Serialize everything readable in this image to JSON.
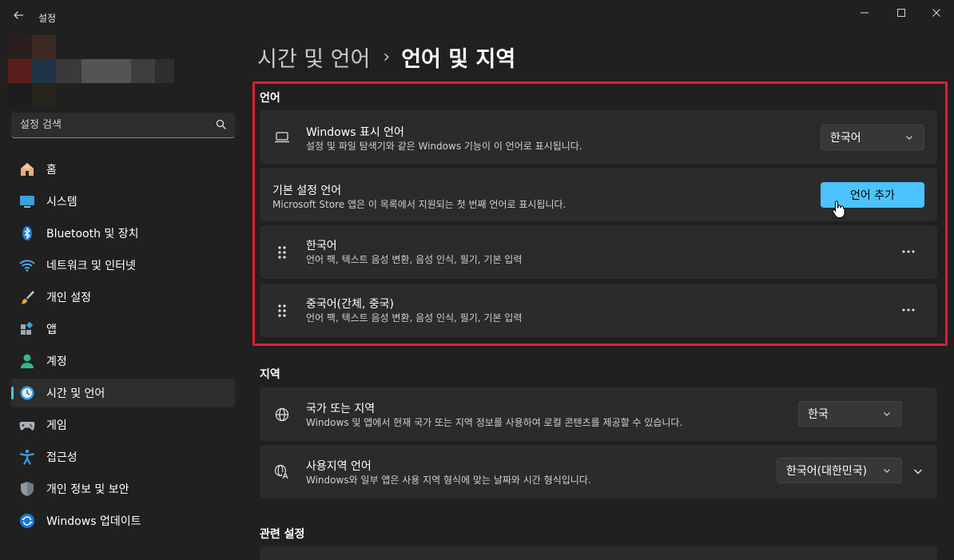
{
  "window": {
    "app_title": "설정",
    "back_icon": "back-arrow-icon"
  },
  "search": {
    "placeholder": "설정 검색"
  },
  "sidebar": {
    "items": [
      {
        "label": "홈",
        "icon": "home-icon"
      },
      {
        "label": "시스템",
        "icon": "system-icon"
      },
      {
        "label": "Bluetooth 및 장치",
        "icon": "bluetooth-icon"
      },
      {
        "label": "네트워크 및 인터넷",
        "icon": "wifi-icon"
      },
      {
        "label": "개인 설정",
        "icon": "brush-icon"
      },
      {
        "label": "앱",
        "icon": "apps-icon"
      },
      {
        "label": "계정",
        "icon": "account-icon"
      },
      {
        "label": "시간 및 언어",
        "icon": "time-language-icon",
        "active": true
      },
      {
        "label": "게임",
        "icon": "gamepad-icon"
      },
      {
        "label": "접근성",
        "icon": "accessibility-icon"
      },
      {
        "label": "개인 정보 및 보안",
        "icon": "shield-icon"
      },
      {
        "label": "Windows 업데이트",
        "icon": "update-icon"
      }
    ]
  },
  "breadcrumb": {
    "parent": "시간 및 언어",
    "separator": "›",
    "current": "언어 및 지역"
  },
  "language_section": {
    "title": "언어",
    "display_language": {
      "title": "Windows 표시 언어",
      "description": "설정 및 파일 탐색기와 같은 Windows 기능이 이 언어로 표시됩니다.",
      "value": "한국어"
    },
    "preferred_languages": {
      "title": "기본 설정 언어",
      "description": "Microsoft Store 앱은 이 목록에서 지원되는 첫 번째 언어로 표시됩니다.",
      "button": "언어 추가"
    },
    "languages": [
      {
        "name": "한국어",
        "features": "언어 팩, 텍스트 음성 변환, 음성 인식, 필기, 기본 입력"
      },
      {
        "name": "중국어(간체, 중국)",
        "features": "언어 팩, 텍스트 음성 변환, 음성 인식, 필기, 기본 입력"
      }
    ]
  },
  "region_section": {
    "title": "지역",
    "country": {
      "title": "국가 또는 지역",
      "description": "Windows 및 앱에서 현재 국가 또는 지역 정보를 사용하여 로컬 콘텐츠를 제공할 수 있습니다.",
      "value": "한국"
    },
    "regional_format": {
      "title": "사용지역 언어",
      "description": "Windows와 일부 앱은 사용 지역 형식에 맞는 날짜와 시간 형식입니다.",
      "value": "한국어(대한민국)"
    }
  },
  "related_section": {
    "title": "관련 설정"
  },
  "colors": {
    "accent": "#4cc2ff",
    "highlight_border": "#e01e2b",
    "background": "#202020",
    "card": "#2b2b2b"
  }
}
